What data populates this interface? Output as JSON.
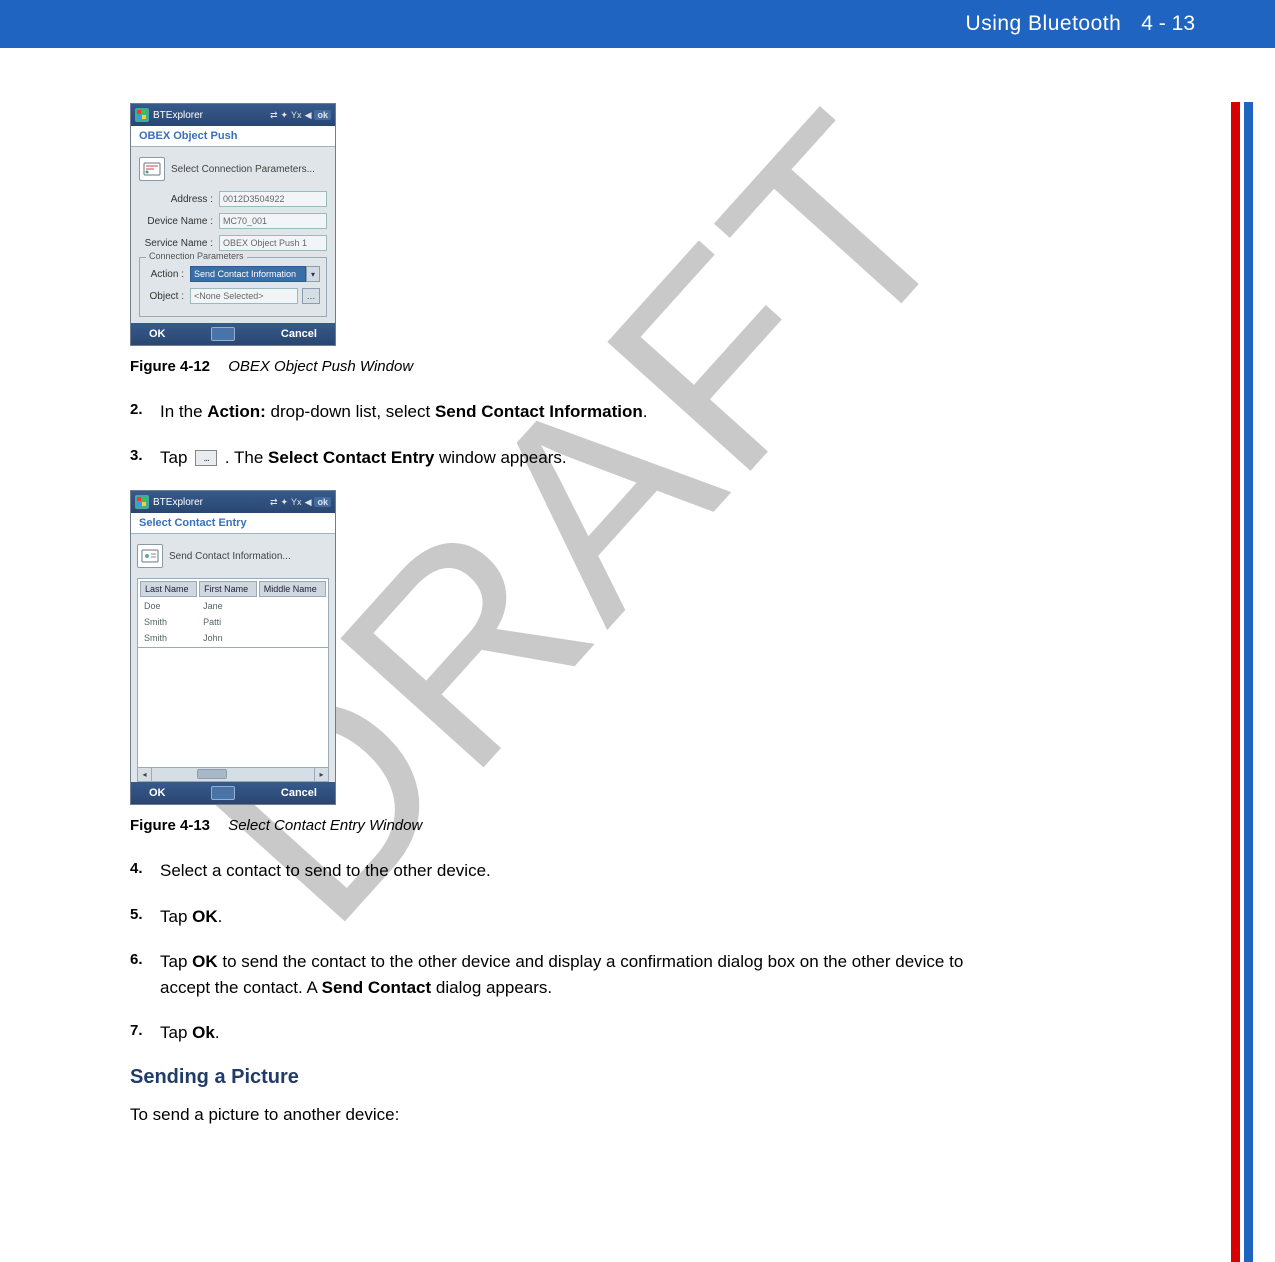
{
  "header": {
    "title": "Using Bluetooth",
    "page": "4 - 13"
  },
  "watermark": "DRAFT",
  "shot1": {
    "app_title": "BTExplorer",
    "tray_ok": "ok",
    "banner": "OBEX Object Push",
    "select_params": "Select Connection Parameters...",
    "address_label": "Address :",
    "address_value": "0012D3504922",
    "device_label": "Device Name :",
    "device_value": "MC70_001",
    "service_label": "Service Name :",
    "service_value": "OBEX Object Push 1",
    "fieldset_legend": "Connection Parameters",
    "action_label": "Action :",
    "action_value": "Send Contact Information",
    "object_label": "Object :",
    "object_value": "<None Selected>",
    "footer_ok": "OK",
    "footer_cancel": "Cancel"
  },
  "caption1": {
    "label": "Figure 4-12",
    "title": "OBEX Object Push Window"
  },
  "step2": {
    "num": "2.",
    "pre": "In the ",
    "b1": "Action:",
    "mid": " drop-down list, select ",
    "b2": "Send Contact Information",
    "post": "."
  },
  "step3": {
    "num": "3.",
    "pre": "Tap ",
    "icon_label": "...",
    "mid": " . The ",
    "b1": "Select Contact Entry",
    "post": " window appears."
  },
  "shot2": {
    "app_title": "BTExplorer",
    "tray_ok": "ok",
    "banner": "Select Contact Entry",
    "select_params": "Send Contact Information...",
    "columns": [
      "Last Name",
      "First Name",
      "Middle Name"
    ],
    "rows": [
      [
        "Doe",
        "Jane",
        ""
      ],
      [
        "Smith",
        "Patti",
        ""
      ],
      [
        "Smith",
        "John",
        ""
      ]
    ],
    "footer_ok": "OK",
    "footer_cancel": "Cancel"
  },
  "caption2": {
    "label": "Figure 4-13",
    "title": "Select Contact Entry Window"
  },
  "step4": {
    "num": "4.",
    "text": "Select a contact to send to the other device."
  },
  "step5": {
    "num": "5.",
    "pre": "Tap ",
    "b1": "OK",
    "post": "."
  },
  "step6": {
    "num": "6.",
    "pre": "Tap ",
    "b1": "OK",
    "mid": " to send the contact to the other device and display a confirmation dialog box on the other device to accept the contact. A ",
    "b2": "Send Contact",
    "post": " dialog appears."
  },
  "step7": {
    "num": "7.",
    "pre": "Tap ",
    "b1": "Ok",
    "post": "."
  },
  "section_head": "Sending a Picture",
  "section_text": "To send a picture to another device:"
}
